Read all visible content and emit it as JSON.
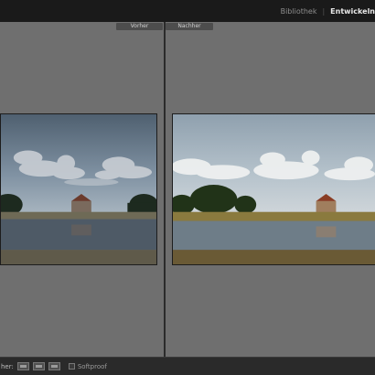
{
  "modules": {
    "library": "Bibliothek",
    "separator": "|",
    "develop": "Entwickeln"
  },
  "panes": {
    "before_label": "Vorher",
    "after_label": "Nachher"
  },
  "toolbar": {
    "view_label": "her:",
    "softproof_label": "Softproof"
  },
  "colors": {
    "background": "#6f6f6f",
    "topbar": "#1a1a1a",
    "toolbar": "#2a2a2a"
  },
  "icons": [
    "view-left-right-icon",
    "view-top-bottom-icon",
    "view-split-icon"
  ]
}
